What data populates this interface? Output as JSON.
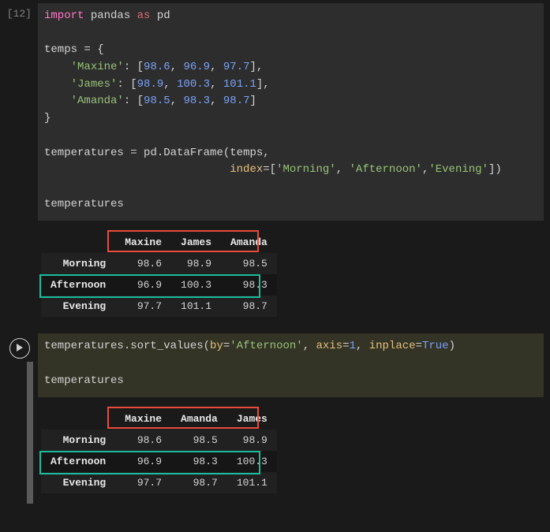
{
  "cell1": {
    "prompt": "[12]",
    "code": {
      "l1_import": "import",
      "l1_pandas": "pandas",
      "l1_as": "as",
      "l1_pd": "pd",
      "l3_temps": "temps",
      "l3_eq": "=",
      "l3_open": "{",
      "l4_key": "'Maxine'",
      "l4_vals": [
        "98.6",
        "96.9",
        "97.7"
      ],
      "l5_key": "'James'",
      "l5_vals": [
        "98.9",
        "100.3",
        "101.1"
      ],
      "l6_key": "'Amanda'",
      "l6_vals": [
        "98.5",
        "98.3",
        "98.7"
      ],
      "l7_close": "}",
      "l9_lhs": "temperatures",
      "l9_eq": "=",
      "l9_call": "pd.DataFrame(temps,",
      "l10_param": "index",
      "l10_eq": "=",
      "l10_list": [
        "'Morning'",
        "'Afternoon'",
        "'Evening'"
      ],
      "l12": "temperatures"
    },
    "output": {
      "columns": [
        "Maxine",
        "James",
        "Amanda"
      ],
      "index": [
        "Morning",
        "Afternoon",
        "Evening"
      ],
      "rows": [
        [
          "98.6",
          "98.9",
          "98.5"
        ],
        [
          "96.9",
          "100.3",
          "98.3"
        ],
        [
          "97.7",
          "101.1",
          "98.7"
        ]
      ]
    }
  },
  "cell2": {
    "code": {
      "l1_lhs": "temperatures.sort_values(",
      "l1_by": "by",
      "l1_byval": "'Afternoon'",
      "l1_axis": "axis",
      "l1_axisval": "1",
      "l1_inplace": "inplace",
      "l1_inplaceval": "True",
      "l1_close": ")",
      "l3": "temperatures"
    },
    "output": {
      "columns": [
        "Maxine",
        "Amanda",
        "James"
      ],
      "index": [
        "Morning",
        "Afternoon",
        "Evening"
      ],
      "rows": [
        [
          "98.6",
          "98.5",
          "98.9"
        ],
        [
          "96.9",
          "98.3",
          "100.3"
        ],
        [
          "97.7",
          "98.7",
          "101.1"
        ]
      ]
    }
  },
  "chart_data": [
    {
      "type": "table",
      "title": "DataFrame (original)",
      "index": [
        "Morning",
        "Afternoon",
        "Evening"
      ],
      "series": [
        {
          "name": "Maxine",
          "values": [
            98.6,
            96.9,
            97.7
          ]
        },
        {
          "name": "James",
          "values": [
            98.9,
            100.3,
            101.1
          ]
        },
        {
          "name": "Amanda",
          "values": [
            98.5,
            98.3,
            98.7
          ]
        }
      ]
    },
    {
      "type": "table",
      "title": "DataFrame (sorted by Afternoon, axis=1)",
      "index": [
        "Morning",
        "Afternoon",
        "Evening"
      ],
      "series": [
        {
          "name": "Maxine",
          "values": [
            98.6,
            96.9,
            97.7
          ]
        },
        {
          "name": "Amanda",
          "values": [
            98.5,
            98.3,
            98.7
          ]
        },
        {
          "name": "James",
          "values": [
            98.9,
            100.3,
            101.1
          ]
        }
      ]
    }
  ]
}
